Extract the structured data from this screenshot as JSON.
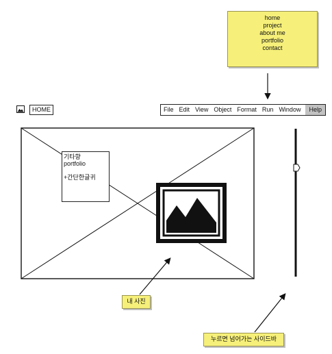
{
  "sticky_note": {
    "items": [
      "home",
      "project",
      "about me",
      "portfolio",
      "contact"
    ]
  },
  "header": {
    "app_icon": "image-icon",
    "title": "HOME"
  },
  "menubar": {
    "items": [
      "File",
      "Edit",
      "View",
      "Object",
      "Format",
      "Run",
      "Window"
    ],
    "help": "Help",
    "active_color": "#c2c2c2"
  },
  "photo_card": {
    "line1": "기타향",
    "line2": "portfolio",
    "line3": "+간단한글귀"
  },
  "annotations": {
    "photo": "내 사진",
    "sidebar": "누르면 넘어가는 사이드바"
  },
  "colors": {
    "note_yellow": "#f6f07a",
    "stroke": "#111111"
  }
}
